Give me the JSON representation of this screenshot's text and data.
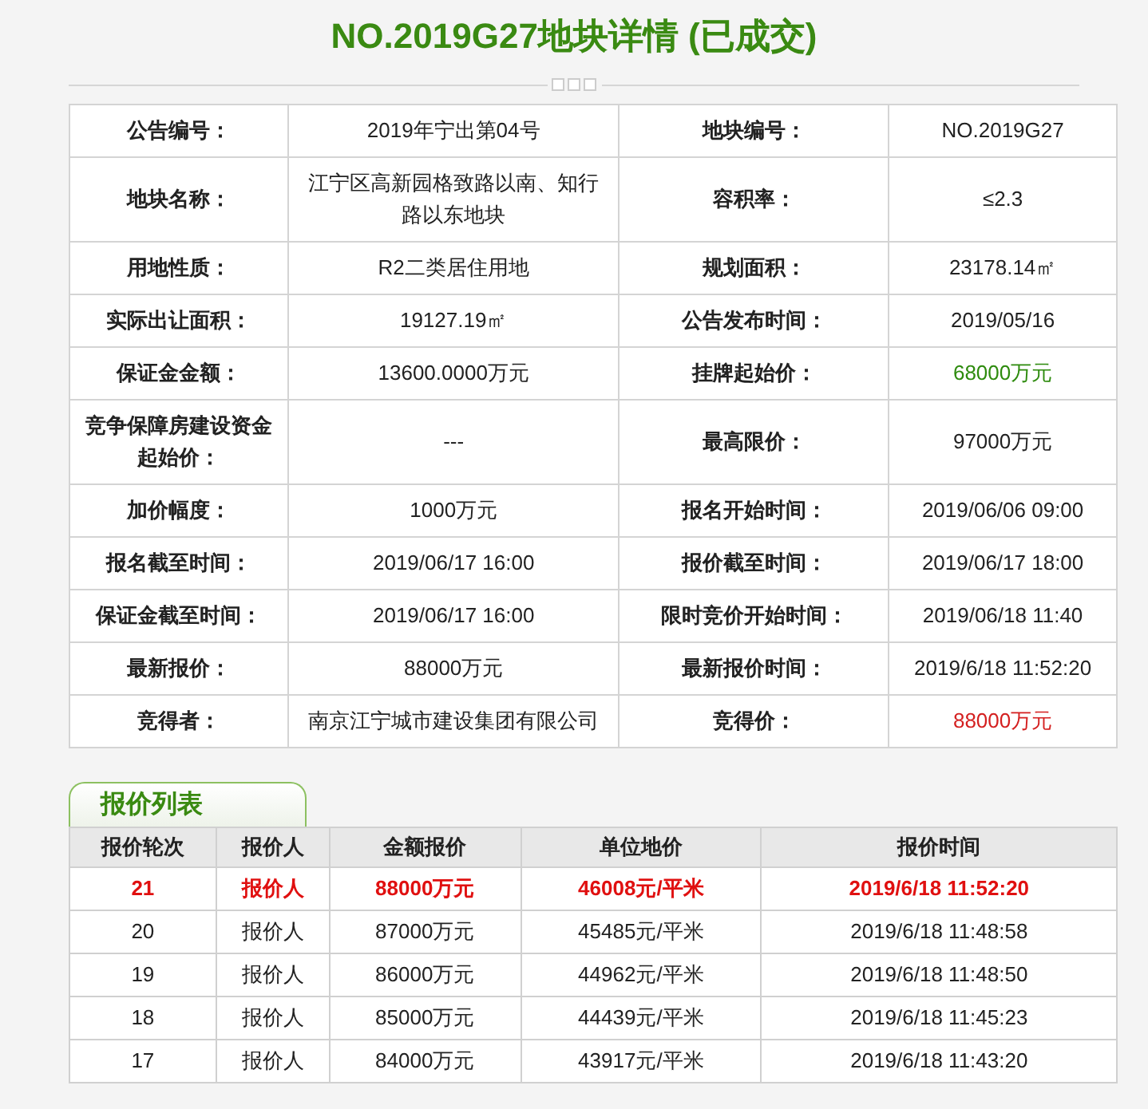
{
  "title": "NO.2019G27地块详情 (已成交)",
  "details": [
    {
      "fields": [
        {
          "label": "公告编号：",
          "value": "2019年宁出第04号"
        },
        {
          "label": "地块编号：",
          "value": "NO.2019G27"
        }
      ]
    },
    {
      "fields": [
        {
          "label": "地块名称：",
          "value": "江宁区高新园格致路以南、知行路以东地块"
        },
        {
          "label": "容积率：",
          "value": "≤2.3"
        }
      ]
    },
    {
      "fields": [
        {
          "label": "用地性质：",
          "value": "R2二类居住用地"
        },
        {
          "label": "规划面积：",
          "value": "23178.14㎡"
        }
      ]
    },
    {
      "fields": [
        {
          "label": "实际出让面积：",
          "value": "19127.19㎡"
        },
        {
          "label": "公告发布时间：",
          "value": "2019/05/16"
        }
      ]
    },
    {
      "fields": [
        {
          "label": "保证金金额：",
          "value": "13600.0000万元"
        },
        {
          "label": "挂牌起始价：",
          "value": "68000万元",
          "color": "#2e8b0e"
        }
      ]
    },
    {
      "fields": [
        {
          "label": "竞争保障房建设资金起始价：",
          "value": "---"
        },
        {
          "label": "最高限价：",
          "value": "97000万元"
        }
      ]
    },
    {
      "fields": [
        {
          "label": "加价幅度：",
          "value": "1000万元"
        },
        {
          "label": "报名开始时间：",
          "value": "2019/06/06 09:00"
        }
      ]
    },
    {
      "fields": [
        {
          "label": "报名截至时间：",
          "value": "2019/06/17 16:00"
        },
        {
          "label": "报价截至时间：",
          "value": "2019/06/17 18:00"
        }
      ]
    },
    {
      "fields": [
        {
          "label": "保证金截至时间：",
          "value": "2019/06/17 16:00"
        },
        {
          "label": "限时竞价开始时间：",
          "value": "2019/06/18 11:40"
        }
      ]
    },
    {
      "fields": [
        {
          "label": "最新报价：",
          "value": "88000万元"
        },
        {
          "label": "最新报价时间：",
          "value": "2019/6/18 11:52:20"
        }
      ]
    },
    {
      "fields": [
        {
          "label": "竞得者：",
          "value": "南京江宁城市建设集团有限公司"
        },
        {
          "label": "竞得价：",
          "value": "88000万元",
          "color": "#d42020"
        }
      ]
    }
  ],
  "bids": {
    "tab": "报价列表",
    "columns": [
      "报价轮次",
      "报价人",
      "金额报价",
      "单位地价",
      "报价时间"
    ],
    "rows": [
      {
        "highlighted": true,
        "cells": [
          "21",
          "报价人",
          "88000万元",
          "46008元/平米",
          "2019/6/18 11:52:20"
        ]
      },
      {
        "highlighted": false,
        "cells": [
          "20",
          "报价人",
          "87000万元",
          "45485元/平米",
          "2019/6/18 11:48:58"
        ]
      },
      {
        "highlighted": false,
        "cells": [
          "19",
          "报价人",
          "86000万元",
          "44962元/平米",
          "2019/6/18 11:48:50"
        ]
      },
      {
        "highlighted": false,
        "cells": [
          "18",
          "报价人",
          "85000万元",
          "44439元/平米",
          "2019/6/18 11:45:23"
        ]
      },
      {
        "highlighted": false,
        "cells": [
          "17",
          "报价人",
          "84000万元",
          "43917元/平米",
          "2019/6/18 11:43:20"
        ]
      }
    ]
  }
}
